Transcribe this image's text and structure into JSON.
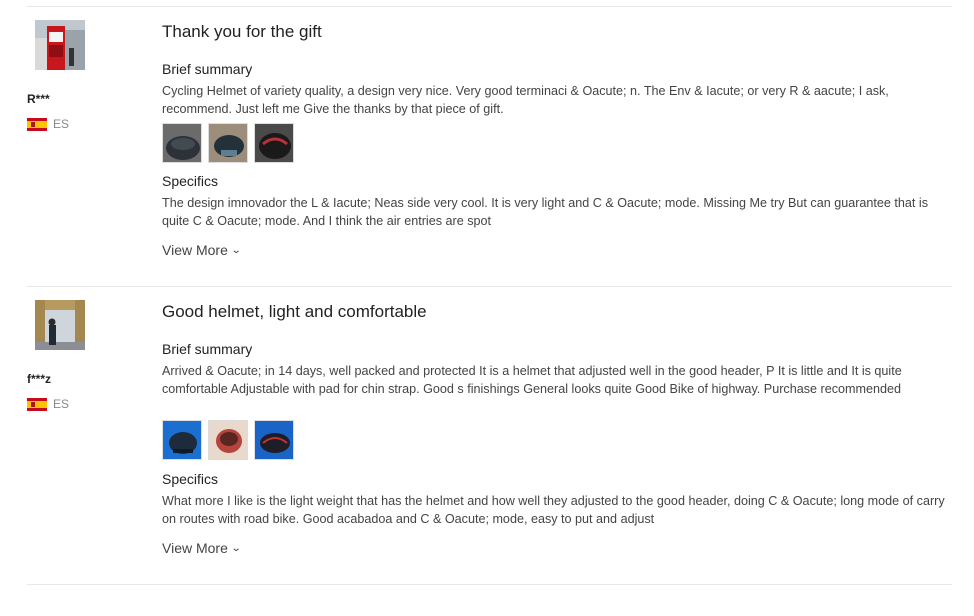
{
  "reviews": [
    {
      "user": "R***",
      "country": "ES",
      "title": "Thank you for the gift",
      "summary_heading": "Brief summary",
      "summary": "Cycling Helmet of variety quality, a design very nice. Very good terminaci & Oacute; n. The Env & Iacute; or very R & aacute; I ask, recommend. Just left me Give the thanks by that piece of gift.",
      "photos": [
        "helmet-photo-1",
        "helmet-photo-2",
        "helmet-photo-3"
      ],
      "specifics_heading": "Specifics",
      "specifics": "The design imnovador the L & Iacute; Neas side very cool. It is very light and C & Oacute; mode. Missing Me try But can guarantee that is quite C & Oacute; mode. And I think the air entries are spot",
      "view_more": "View More"
    },
    {
      "user": "f***z",
      "country": "ES",
      "title": "Good helmet, light and comfortable",
      "summary_heading": "Brief summary",
      "summary": "Arrived & Oacute; in 14 days, well packed and protected It is a helmet that adjusted well in the good header, P It is little and It is quite comfortable Adjustable with pad for chin strap. Good s finishings General looks quite Good Bike of highway. Purchase recommended",
      "photos": [
        "helmet-photo-1",
        "helmet-photo-2",
        "helmet-photo-3"
      ],
      "specifics_heading": "Specifics",
      "specifics": "What more I like is the light weight that has the helmet and how well they adjusted to the good header, doing C & Oacute; long mode of carry on routes with road bike. Good acabadoa and C & Oacute; mode, easy to put and adjust",
      "view_more": "View More"
    }
  ]
}
